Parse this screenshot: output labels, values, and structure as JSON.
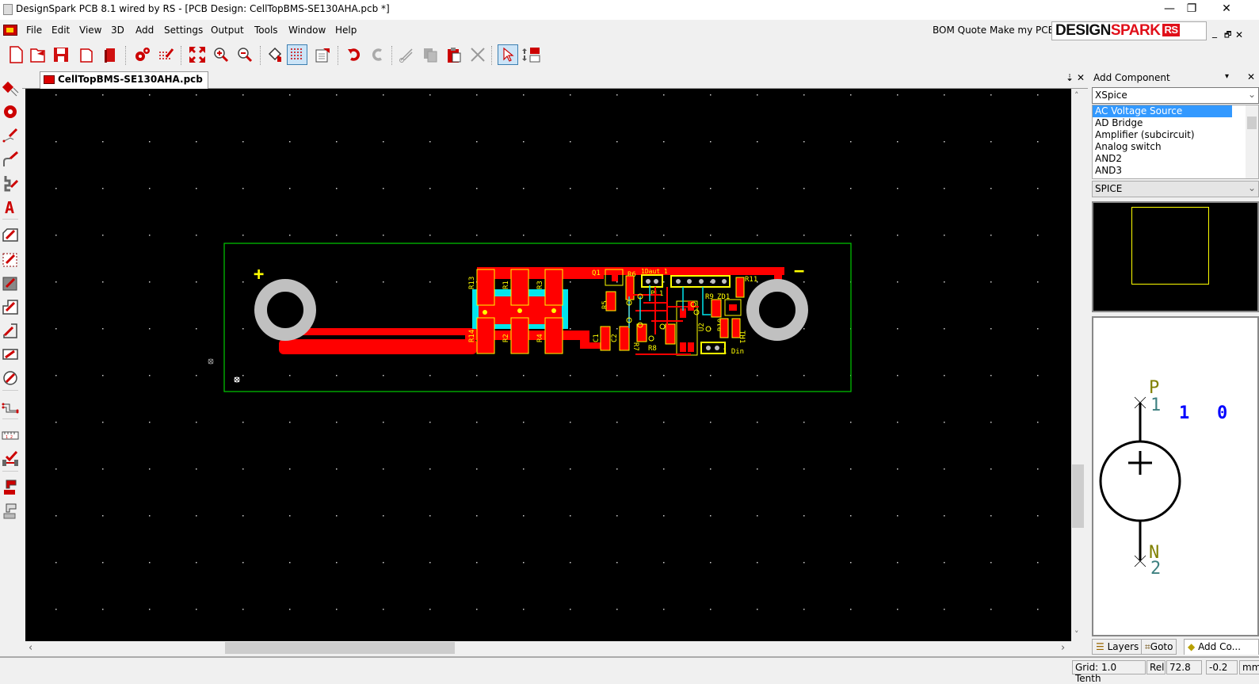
{
  "window": {
    "title": "DesignSpark PCB 8.1 wired by RS - [PCB Design: CellTopBMS-SE130AHA.pcb *]",
    "minimize": "—",
    "maximize": "❐",
    "close": "✕"
  },
  "menu": {
    "items": [
      "File",
      "Edit",
      "View",
      "3D",
      "Add",
      "Settings",
      "Output",
      "Tools",
      "Window",
      "Help"
    ],
    "bom_quote": "BOM Quote",
    "make_pcb": "Make my PCB",
    "logo": {
      "design": "DESIGN",
      "spark": "SPARK",
      "rs": "RS"
    },
    "mdi_minimize": "_",
    "mdi_restore": "🗗",
    "mdi_close": "✕"
  },
  "toolbar": {
    "buttons": [
      "new",
      "open",
      "save",
      "save-all",
      "library",
      "design-settings",
      "grid-settings",
      "zoom-fit",
      "zoom-in",
      "zoom-out",
      "fill",
      "grid-toggle",
      "properties",
      "undo",
      "redo",
      "cut",
      "copy",
      "paste",
      "delete",
      "select",
      "interaction-bar"
    ],
    "active": [
      "grid-toggle",
      "select"
    ]
  },
  "left_tools": [
    "add-component",
    "add-via",
    "add-track",
    "add-track-curved",
    "add-track-push",
    "add-text",
    "add-shape",
    "add-template",
    "add-copper",
    "add-board-cutout",
    "add-board",
    "add-rectangle",
    "add-circle",
    "route-net",
    "add-dimension",
    "design-rule-check",
    "pour-copper",
    "unpour-copper"
  ],
  "document": {
    "tab_label": "CellTopBMS-SE130AHA.pcb",
    "pane_pin": "⇣",
    "pane_close": "✕"
  },
  "pcb": {
    "plus_label": "+",
    "minus_label": "−",
    "components": [
      "R13",
      "R1",
      "R3",
      "R14",
      "R2",
      "R4",
      "Q1",
      "R6",
      "1Daut 1",
      "R11",
      "R5",
      "PL1",
      "R9",
      "ZD1",
      "C1",
      "C2",
      "R7",
      "R8",
      "U2",
      "R10",
      "TH1",
      "1 Din"
    ],
    "colors": {
      "board_outline": "#00cc00",
      "copper": "#ff0000",
      "silkscreen": "#ffff00",
      "keepout": "#00e5ee",
      "mounting_hole": "#c0c0c0",
      "label_magenta": "#ff33cc"
    }
  },
  "right_panel": {
    "header": "Add Component",
    "header_pin": "▾",
    "header_close": "✕",
    "library_select": "XSpice",
    "components": [
      "AC Voltage Source",
      "AD Bridge",
      "Amplifier (subcircuit)",
      "Analog switch",
      "AND2",
      "AND3"
    ],
    "selected_index": 0,
    "type_select": "SPICE",
    "symbol": {
      "pin1_name": "P",
      "pin1_num": "1",
      "pin2_name": "N",
      "pin2_num": "2",
      "value1": "1",
      "value2": "0"
    },
    "tabs": [
      "Layers",
      "Goto",
      "Add Co..."
    ],
    "active_tab": 2
  },
  "status": {
    "grid": "Grid: 1.0 Tenth",
    "rel": "Rel",
    "x": "72.8",
    "y": "-0.2",
    "units": "mm"
  }
}
